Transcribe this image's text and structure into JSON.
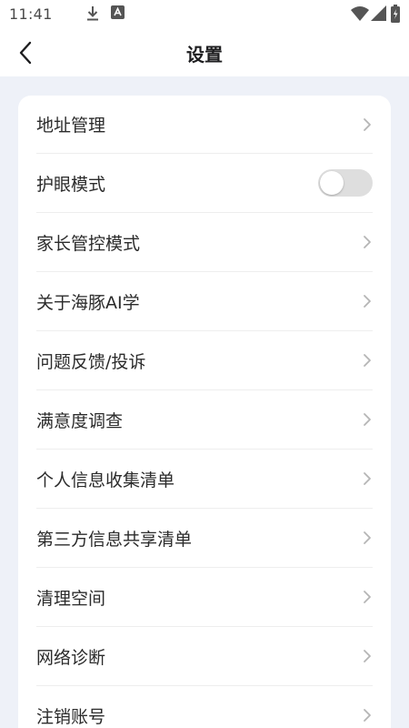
{
  "status_bar": {
    "time": "11:41",
    "icons": [
      "download-icon",
      "app-badge-icon",
      "wifi-icon",
      "signal-icon",
      "battery-icon"
    ]
  },
  "header": {
    "title": "设置",
    "back_icon": "chevron-left-icon"
  },
  "settings": {
    "items": [
      {
        "label": "地址管理",
        "control": "chevron"
      },
      {
        "label": "护眼模式",
        "control": "toggle",
        "toggle_on": false
      },
      {
        "label": "家长管控模式",
        "control": "chevron"
      },
      {
        "label": "关于海豚AI学",
        "control": "chevron"
      },
      {
        "label": "问题反馈/投诉",
        "control": "chevron"
      },
      {
        "label": "满意度调查",
        "control": "chevron"
      },
      {
        "label": "个人信息收集清单",
        "control": "chevron"
      },
      {
        "label": "第三方信息共享清单",
        "control": "chevron"
      },
      {
        "label": "清理空间",
        "control": "chevron"
      },
      {
        "label": "网络诊断",
        "control": "chevron"
      },
      {
        "label": "注销账号",
        "control": "chevron"
      }
    ]
  },
  "colors": {
    "page_background": "#eef1f8",
    "card_background": "#ffffff",
    "toggle_off": "#dedede",
    "text_primary": "#2b2b2b",
    "chevron": "#b5b5b5"
  }
}
